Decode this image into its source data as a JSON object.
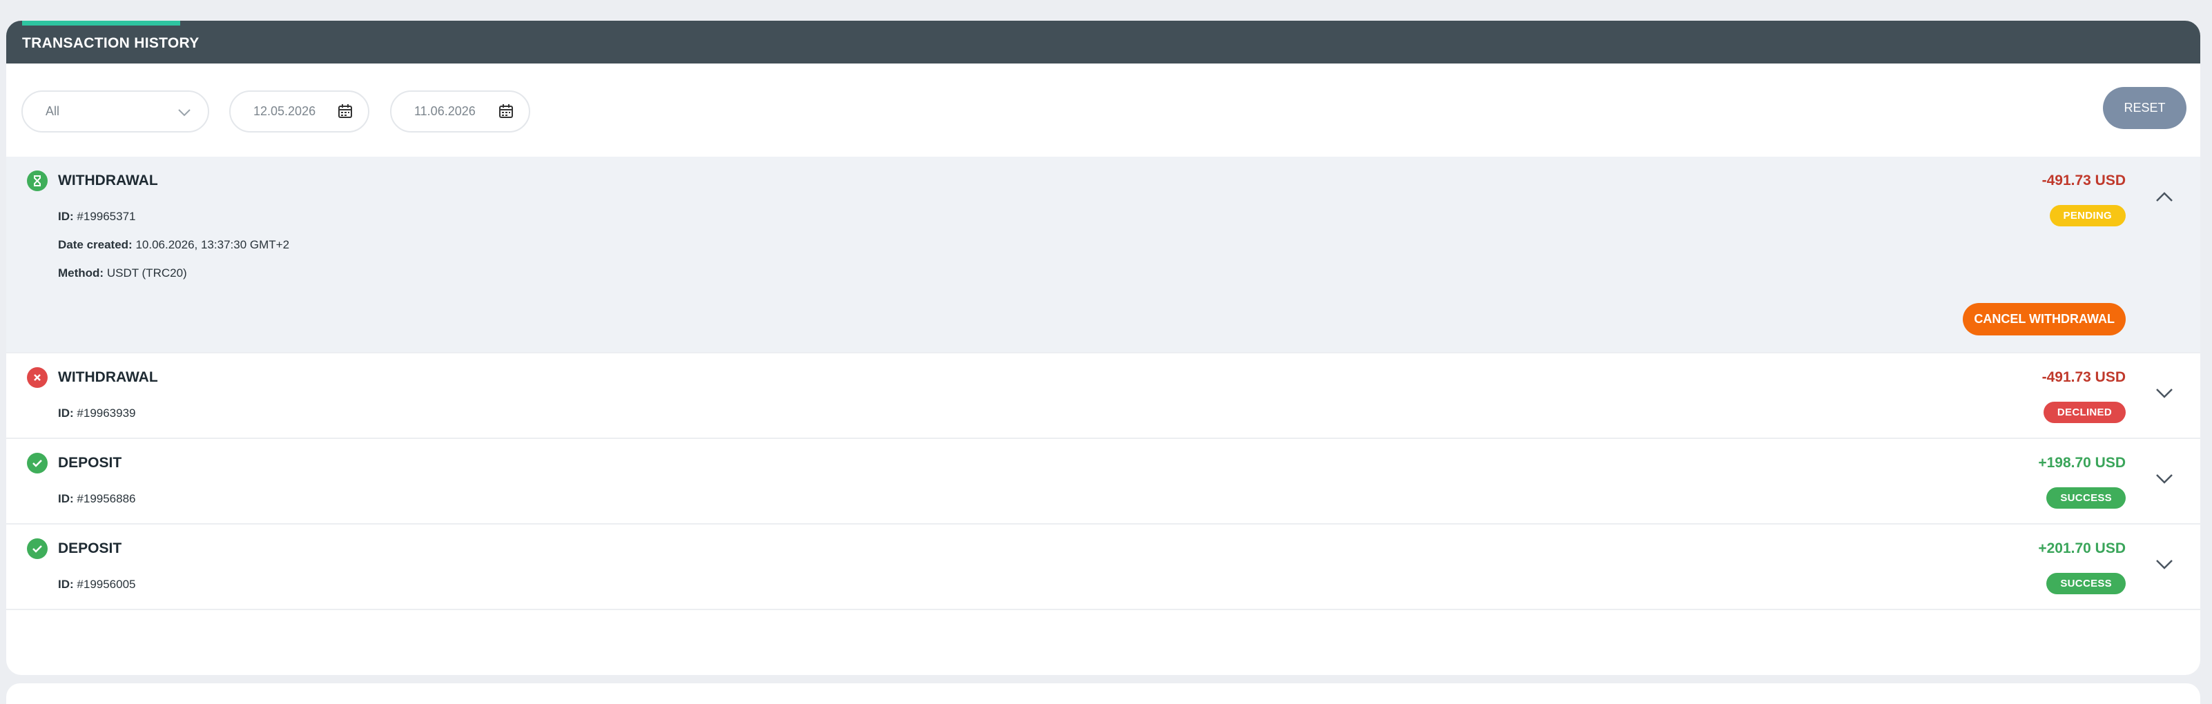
{
  "header": {
    "title": "TRANSACTION HISTORY"
  },
  "filters": {
    "type_value": "All",
    "date_from": "12.05.2026",
    "date_to": "11.06.2026",
    "reset_label": "RESET"
  },
  "labels": {
    "id": "ID:",
    "date_created": "Date created:",
    "method": "Method:"
  },
  "colors": {
    "pending": "#f8c513",
    "declined": "#e04848",
    "success": "#3fae5a",
    "cancel": "#f46a0a",
    "header_bg": "#424f57",
    "accent": "#2ec4a0"
  },
  "transactions": [
    {
      "type": "WITHDRAWAL",
      "status_icon": "hourglass-icon",
      "id": "#19965371",
      "date_created": "10.06.2026, 13:37:30 GMT+2",
      "method": "USDT (TRC20)",
      "amount": "-491.73 USD",
      "status": "PENDING",
      "action_label": "CANCEL WITHDRAWAL",
      "expanded": true
    },
    {
      "type": "WITHDRAWAL",
      "status_icon": "x-circle-icon",
      "id": "#19963939",
      "amount": "-491.73 USD",
      "status": "DECLINED",
      "expanded": false
    },
    {
      "type": "DEPOSIT",
      "status_icon": "check-circle-icon",
      "id": "#19956886",
      "amount": "+198.70 USD",
      "status": "SUCCESS",
      "expanded": false
    },
    {
      "type": "DEPOSIT",
      "status_icon": "check-circle-icon",
      "id": "#19956005",
      "amount": "+201.70 USD",
      "status": "SUCCESS",
      "expanded": false
    }
  ]
}
